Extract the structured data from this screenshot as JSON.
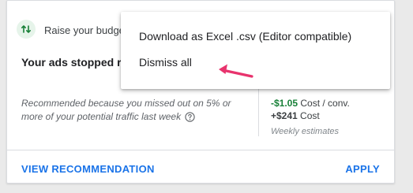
{
  "card": {
    "type_label": "Raise your budget",
    "headline": "Your ads stopped running on your busiest days. Fixing your limited budget",
    "reason": "Recommended because you missed out on 5% or more of your potential traffic last week",
    "metrics": [
      {
        "value": "-$1.05",
        "label": "Cost / conv.",
        "color": "#188038"
      },
      {
        "value": "+$241",
        "label": "Cost",
        "color": "#202124"
      }
    ],
    "weekly_note": "Weekly estimates",
    "view_label": "VIEW RECOMMENDATION",
    "apply_label": "APPLY"
  },
  "menu": {
    "items": [
      {
        "label": "Download as Excel .csv (Editor compatible)"
      },
      {
        "label": "Dismiss all"
      }
    ]
  },
  "colors": {
    "accent": "#1a73e8",
    "positive": "#188038",
    "annotation": "#e8336d"
  },
  "icons": {
    "type_icon": "arrows-up-down-icon",
    "help_icon": "help-circle-icon"
  }
}
